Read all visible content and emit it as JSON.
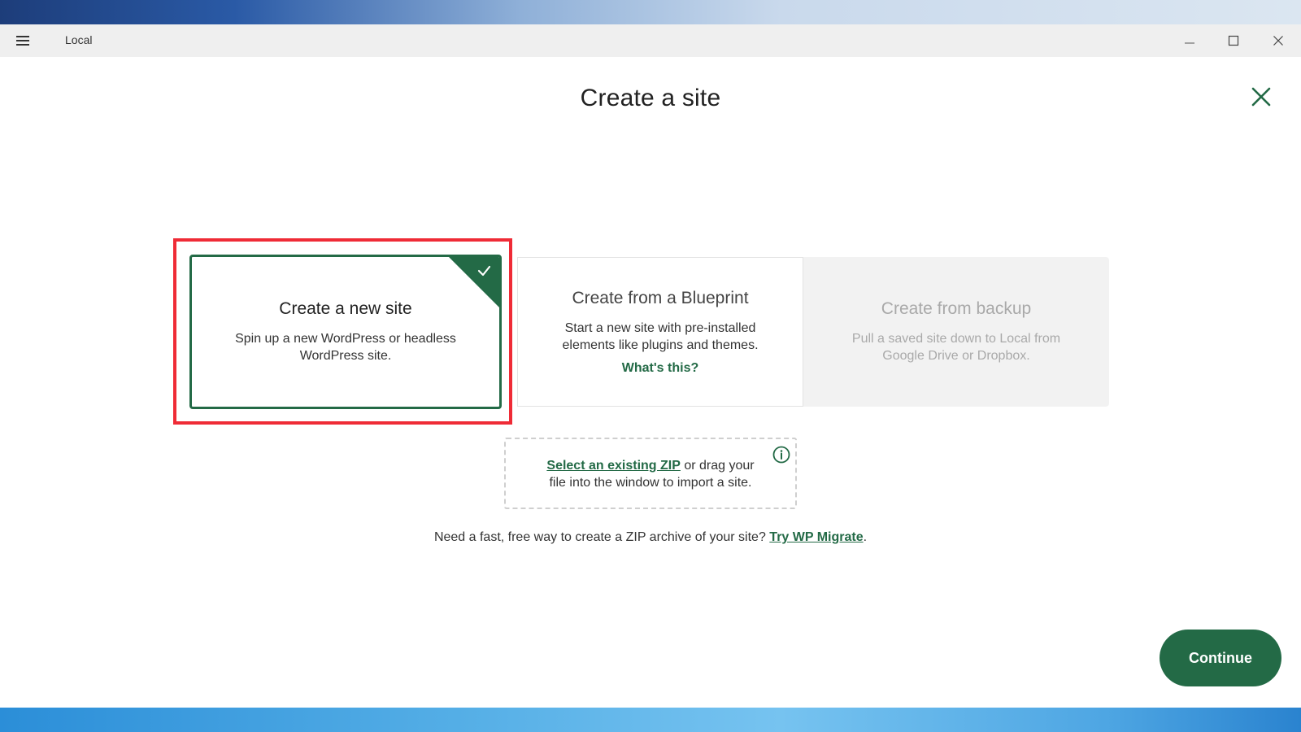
{
  "window": {
    "app_title": "Local",
    "menu_icon": "hamburger-menu-icon",
    "controls": [
      "minimize-icon",
      "maximize-icon",
      "close-icon"
    ]
  },
  "page": {
    "title": "Create a site",
    "close_icon": "close-icon"
  },
  "cards": [
    {
      "title": "Create a new site",
      "description": "Spin up a new WordPress or headless WordPress site.",
      "selected": true,
      "badge_icon": "checkmark-icon"
    },
    {
      "title": "Create from a Blueprint",
      "description": "Start a new site with pre-installed elements like plugins and themes.",
      "link": "What's this?",
      "selected": false
    },
    {
      "title": "Create from backup",
      "description": "Pull a saved site down to Local from Google Drive or Dropbox.",
      "selected": false,
      "disabled": true
    }
  ],
  "zip": {
    "link": "Select an existing ZIP",
    "text_after_link": " or drag your",
    "text_line2": "file into the window to import a site.",
    "info_icon": "info-icon"
  },
  "migrate": {
    "text": "Need a fast, free way to create a ZIP archive of your site? ",
    "link": "Try WP Migrate",
    "suffix": "."
  },
  "footer": {
    "continue_label": "Continue"
  },
  "colors": {
    "accent": "#236a46",
    "highlight": "#ef2b36",
    "disabled_text": "#a9a9a9"
  }
}
